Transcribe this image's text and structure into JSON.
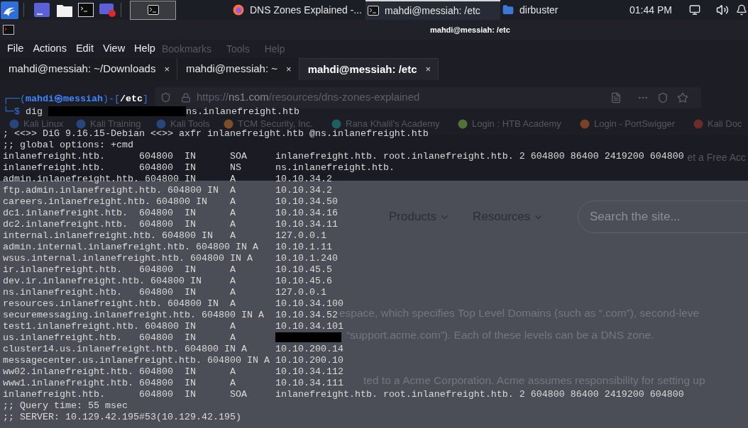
{
  "taskbar": {
    "tasks": [
      {
        "kind": "browser",
        "label": "DNS Zones Explained -...",
        "selected": false
      },
      {
        "kind": "terminal",
        "label": "mahdi@messiah: /etc",
        "selected": true
      },
      {
        "kind": "folder",
        "label": "dirbuster",
        "selected": false
      }
    ],
    "clock": "01:44 PM"
  },
  "browser": {
    "menu": [
      "Bookmarks",
      "Tools",
      "Help"
    ],
    "url": {
      "scheme": "https://",
      "host": "ns1.com",
      "path": "/resources/dns-zones-explained"
    },
    "bookmarks": [
      "Kali Linux",
      "Kali Training",
      "Kali Tools",
      "TCM Security, Inc.",
      "Rana Khalil's Academy",
      "Login : HTB Academy",
      "Login - PortSwigger",
      "Kali Doc"
    ],
    "banner_button": "et a Free Acc",
    "nav": [
      "Products",
      "Resources"
    ],
    "search": {
      "placeholder": "Search the site..."
    },
    "fragments": [
      "espace, which specifies Top Level Domains (such as “.com”), second-leve",
      "“support.acme.com”). Each of these levels can be a DNS zone.",
      "ted to a Acme Corporation. Acme assumes responsibility for setting up"
    ]
  },
  "terminal": {
    "title": "mahdi@messiah: /etc",
    "menu": [
      "File",
      "Actions",
      "Edit",
      "View",
      "Help"
    ],
    "tabs": [
      {
        "label": "mahdi@messiah: ~/Downloads",
        "close": "×",
        "selected": false
      },
      {
        "label": "mahdi@messiah: ~",
        "close": "×",
        "selected": false
      },
      {
        "label": "mahdi@messiah: /etc",
        "close": "×",
        "selected": true
      }
    ],
    "lines": [
      {
        "kind": "prompt",
        "segments": [
          {
            "kind": "frame",
            "text": "┌──("
          },
          {
            "kind": "user",
            "text": "mahdi㉿messiah"
          },
          {
            "kind": "frame",
            "text": ")-["
          },
          {
            "kind": "path",
            "text": "/etc"
          },
          {
            "kind": "frame",
            "text": "]"
          }
        ]
      },
      {
        "kind": "command",
        "segments": [
          {
            "kind": "frame",
            "text": "└─$"
          },
          {
            "kind": "text",
            "text": " dig "
          },
          {
            "kind": "redaction"
          },
          {
            "kind": "text",
            "text": "ns.inlanefreight.htb"
          }
        ]
      },
      {
        "kind": "output",
        "text": "; <<>> DiG 9.16.15-Debian <<>> axfr inlanefreight.htb @ns.inlanefreight.htb"
      },
      {
        "kind": "output",
        "text": ";; global options: +cmd"
      },
      {
        "kind": "output",
        "text": "inlanefreight.htb.      604800  IN      SOA     inlanefreight.htb. root.inlanefreight.htb. 2 604800 86400 2419200 604800"
      },
      {
        "kind": "output",
        "text": "inlanefreight.htb.      604800  IN      NS      ns.inlanefreight.htb."
      },
      {
        "kind": "output",
        "text": "admin.inlanefreight.htb. 604800 IN      A       10.10.34.2"
      },
      {
        "kind": "output",
        "text": "ftp.admin.inlanefreight.htb. 604800 IN  A       10.10.34.2"
      },
      {
        "kind": "output",
        "text": "careers.inlanefreight.htb. 604800 IN    A       10.10.34.50"
      },
      {
        "kind": "output",
        "text": "dc1.inlanefreight.htb.  604800  IN      A       10.10.34.16"
      },
      {
        "kind": "output",
        "text": "dc2.inlanefreight.htb.  604800  IN      A       10.10.34.11"
      },
      {
        "kind": "output",
        "text": "internal.inlanefreight.htb. 604800 IN   A       127.0.0.1"
      },
      {
        "kind": "output",
        "text": "admin.internal.inlanefreight.htb. 604800 IN A   10.10.1.11"
      },
      {
        "kind": "output",
        "text": "wsus.internal.inlanefreight.htb. 604800 IN A    10.10.1.240"
      },
      {
        "kind": "output",
        "text": "ir.inlanefreight.htb.   604800  IN      A       10.10.45.5"
      },
      {
        "kind": "output",
        "text": "dev.ir.inlanefreight.htb. 604800 IN     A       10.10.45.6"
      },
      {
        "kind": "output",
        "text": "ns.inlanefreight.htb.   604800  IN      A       127.0.0.1"
      },
      {
        "kind": "output",
        "text": "resources.inlanefreight.htb. 604800 IN  A       10.10.34.100"
      },
      {
        "kind": "output",
        "text": "securemessaging.inlanefreight.htb. 604800 IN A  10.10.34.52"
      },
      {
        "kind": "output",
        "text": "test1.inlanefreight.htb. 604800 IN      A       10.10.34.101"
      },
      {
        "kind": "output",
        "segments": [
          {
            "kind": "text",
            "text": "us.inlanefreight.htb.   604800  IN      A       "
          },
          {
            "kind": "redaction"
          }
        ]
      },
      {
        "kind": "output",
        "text": "cluster14.us.inlanefreight.htb. 604800 IN A     10.10.200.14"
      },
      {
        "kind": "output",
        "text": "messagecenter.us.inlanefreight.htb. 604800 IN A 10.10.200.10"
      },
      {
        "kind": "output",
        "text": "ww02.inlanefreight.htb. 604800  IN      A       10.10.34.112"
      },
      {
        "kind": "output",
        "text": "www1.inlanefreight.htb. 604800  IN      A       10.10.34.111"
      },
      {
        "kind": "output",
        "text": "inlanefreight.htb.      604800  IN      SOA     inlanefreight.htb. root.inlanefreight.htb. 2 604800 86400 2419200 604800"
      },
      {
        "kind": "output",
        "text": ";; Query time: 55 msec"
      },
      {
        "kind": "output",
        "text": ";; SERVER: 10.129.42.195#53(10.129.42.195)"
      }
    ]
  }
}
